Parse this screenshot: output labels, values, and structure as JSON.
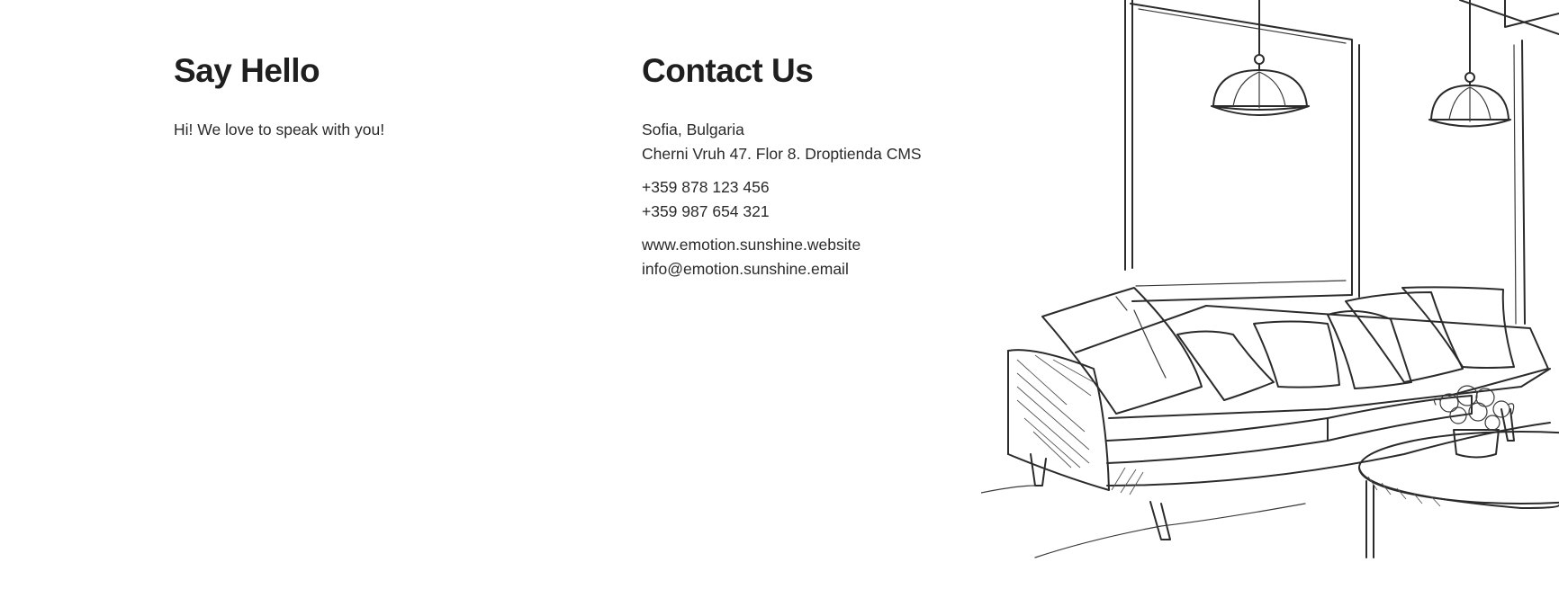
{
  "say_hello": {
    "title": "Say Hello",
    "text": "Hi! We love to speak with you!"
  },
  "contact": {
    "title": "Contact Us",
    "city": "Sofia, Bulgaria",
    "address": "Cherni Vruh 47. Flor 8. Droptienda CMS",
    "phone_1": "+359 878 123 456",
    "phone_2": "+359 987 654 321",
    "website": "www.emotion.sunshine.website",
    "email": "info@emotion.sunshine.email"
  },
  "illustration": {
    "icon": "sofa-room-sketch-illustration",
    "stroke_color": "#2b2b2b"
  }
}
